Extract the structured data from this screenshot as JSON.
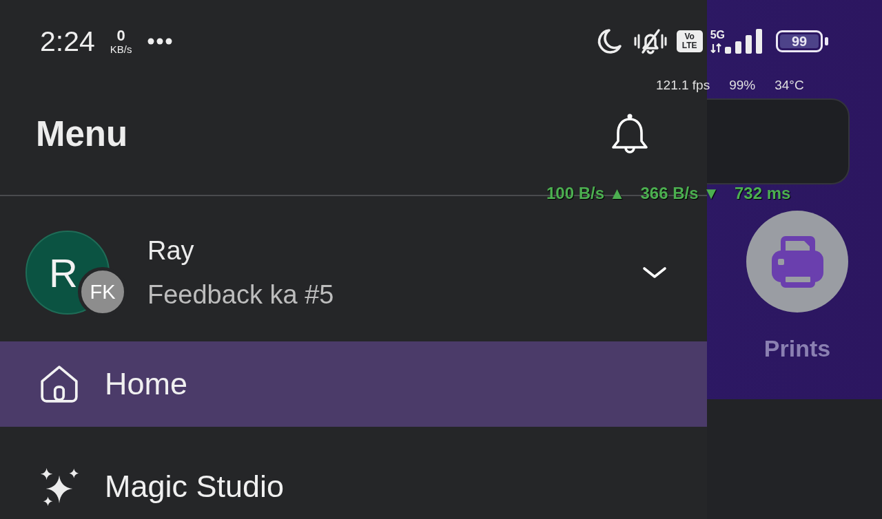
{
  "status_bar": {
    "time": "2:24",
    "net_speed": {
      "value": "0",
      "unit": "KB/s"
    },
    "volte": {
      "top": "Vo",
      "bottom": "LTE"
    },
    "network_type": "5G",
    "battery": "99"
  },
  "perf_overlay": [
    "121.1 fps",
    "99%",
    "34°C"
  ],
  "drawer": {
    "title": "Menu",
    "account": {
      "initial": "R",
      "badge": "FK",
      "name": "Ray",
      "team": "Feedback ka #5",
      "expanded": false
    },
    "nav_items": [
      {
        "label": "Home",
        "selected": true
      },
      {
        "label": "Magic Studio",
        "selected": false
      }
    ]
  },
  "network_overlay": [
    "100 B/s ▲",
    "366 B/s ▼",
    "732 ms"
  ],
  "app_behind": {
    "shortcut": {
      "label": "Prints"
    }
  }
}
